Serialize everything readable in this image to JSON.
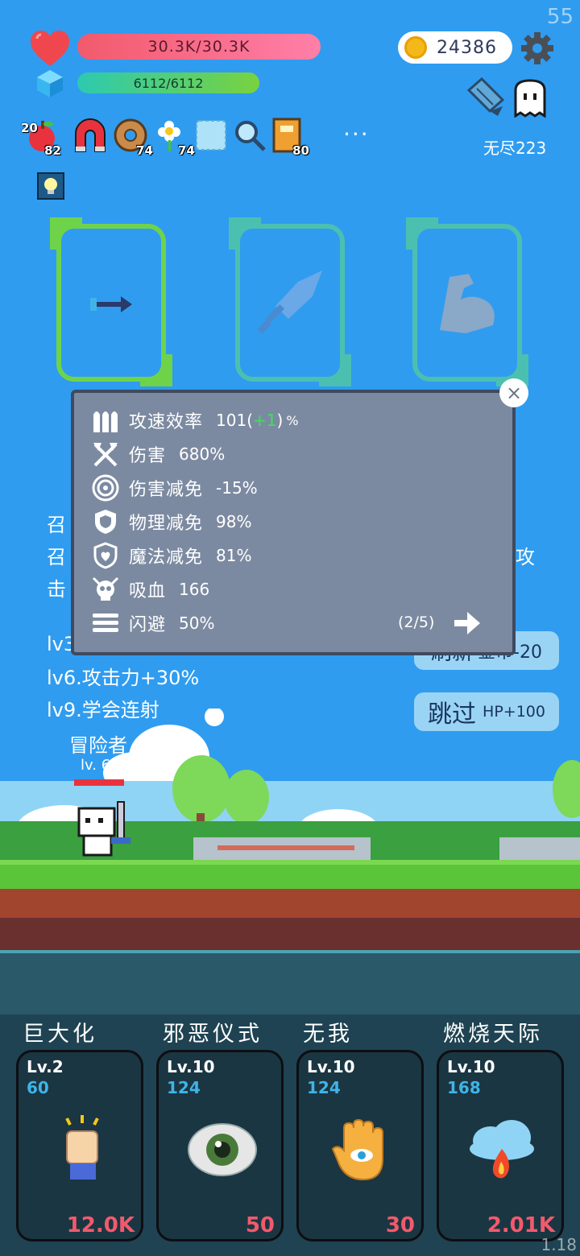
{
  "fps": "55",
  "version": "1.18",
  "hud": {
    "hp_text": "30.3K/30.3K",
    "mp_text": "6112/6112",
    "coins": "24386",
    "endless": "无尽223",
    "more": "···"
  },
  "items": [
    {
      "name": "apple",
      "left_count": "20",
      "count": "82"
    },
    {
      "name": "magnet",
      "count": ""
    },
    {
      "name": "donut",
      "count": "74"
    },
    {
      "name": "flower",
      "count": "74"
    },
    {
      "name": "ice-block",
      "count": ""
    },
    {
      "name": "magnifier",
      "count": ""
    },
    {
      "name": "book",
      "count": "80"
    }
  ],
  "behind_text": {
    "line1": "召",
    "line2": "召",
    "line2_end": "攻",
    "line3": "击",
    "line4": "lv3",
    "line5": "lv6.攻击力+30%",
    "line6": "lv9.学会连射",
    "refresh_label": "刷新",
    "refresh_cost": "金币-20",
    "skip_label": "跳过",
    "skip_bonus": "HP+100",
    "hero_name": "冒险者",
    "hero_level": "lv. 6"
  },
  "stats": {
    "rows": [
      {
        "icon": "bullets-icon",
        "name": "攻速效率",
        "value": "101",
        "bonus": "+1",
        "suffix": "%"
      },
      {
        "icon": "axes-icon",
        "name": "伤害",
        "value": "680%"
      },
      {
        "icon": "target-icon",
        "name": "伤害减免",
        "value": "-15%"
      },
      {
        "icon": "shield-icon",
        "name": "物理减免",
        "value": "98%"
      },
      {
        "icon": "magic-shield-icon",
        "name": "魔法减免",
        "value": "81%"
      },
      {
        "icon": "skull-icon",
        "name": "吸血",
        "value": "166"
      },
      {
        "icon": "dodge-icon",
        "name": "闪避",
        "value": "50%"
      }
    ],
    "page": "(2/5)",
    "close": "×"
  },
  "skills": [
    {
      "title": "巨大化",
      "lv": "Lv.2",
      "num": "60",
      "cost": "12.0K"
    },
    {
      "title": "邪恶仪式",
      "lv": "Lv.10",
      "num": "124",
      "cost": "50"
    },
    {
      "title": "无我",
      "lv": "Lv.10",
      "num": "124",
      "cost": "30"
    },
    {
      "title": "燃烧天际",
      "lv": "Lv.10",
      "num": "168",
      "cost": "2.01K"
    }
  ],
  "colors": {
    "sky": "#2f9cf0",
    "hp": "#f25a6c",
    "mp": "#2ccab0",
    "bonus": "#3ee05a",
    "cost": "#f25a6c",
    "lv_num": "#3fb4e8"
  }
}
